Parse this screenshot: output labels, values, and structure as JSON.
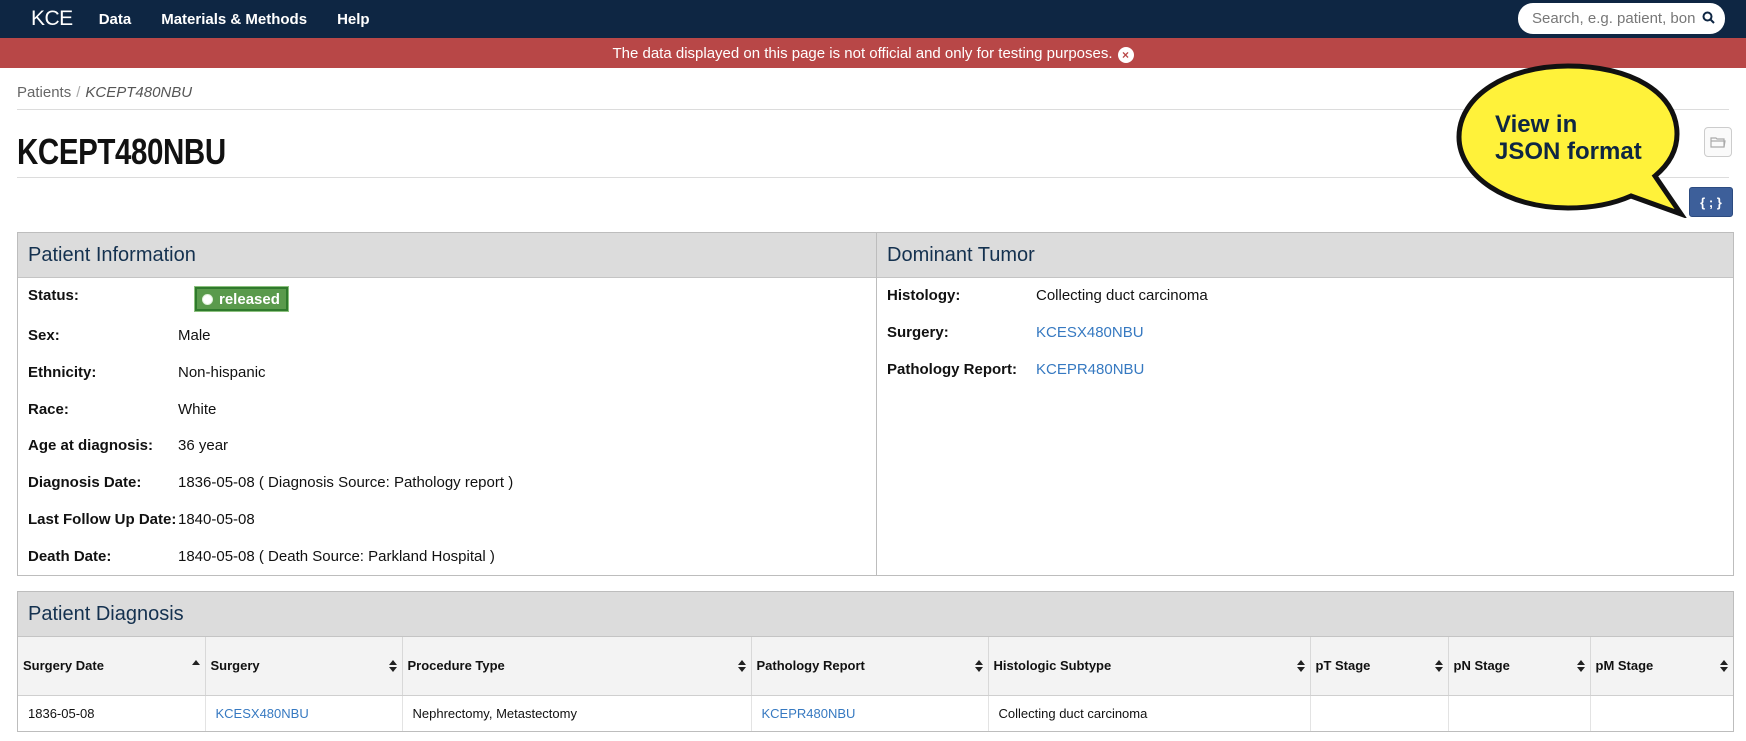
{
  "nav": {
    "brand": "KCE",
    "links": [
      "Data",
      "Materials & Methods",
      "Help"
    ],
    "search_placeholder": "Search, e.g. patient, bon"
  },
  "alert": {
    "text": "The data displayed on this page is not official and only for testing purposes."
  },
  "breadcrumb": {
    "root": "Patients",
    "separator": "/",
    "current": "KCEPT480NBU"
  },
  "page_title": "KCEPT480NBU",
  "callout": {
    "line1": "View in",
    "line2": "JSON format",
    "bubble_color": "#fff23a"
  },
  "json_button": {
    "label": "{ ; }"
  },
  "patient_info": {
    "heading": "Patient Information",
    "status_label": "Status:",
    "status_value": "released",
    "status_color": "#5a9a4c",
    "rows": [
      {
        "label": "Sex:",
        "value": "Male"
      },
      {
        "label": "Ethnicity:",
        "value": "Non-hispanic"
      },
      {
        "label": "Race:",
        "value": "White"
      },
      {
        "label": "Age at diagnosis:",
        "value": "36 year"
      },
      {
        "label": "Diagnosis Date:",
        "value": "1836-05-08 ( Diagnosis Source: Pathology report )"
      },
      {
        "label": "Last Follow Up Date:",
        "value": "1840-05-08"
      },
      {
        "label": "Death Date:",
        "value": "1840-05-08 ( Death Source: Parkland Hospital )"
      }
    ]
  },
  "dominant_tumor": {
    "heading": "Dominant Tumor",
    "histology_label": "Histology:",
    "histology_value": "Collecting duct carcinoma",
    "surgery_label": "Surgery:",
    "surgery_value": "KCESX480NBU",
    "pathology_label": "Pathology Report:",
    "pathology_value": "KCEPR480NBU"
  },
  "diagnosis": {
    "heading": "Patient Diagnosis",
    "columns": [
      "Surgery Date",
      "Surgery",
      "Procedure Type",
      "Pathology Report",
      "Histologic Subtype",
      "pT Stage",
      "pN Stage",
      "pM Stage"
    ],
    "rows": [
      [
        "1836-05-08",
        "KCESX480NBU",
        "Nephrectomy, Metastectomy",
        "KCEPR480NBU",
        "Collecting duct carcinoma",
        "",
        "",
        ""
      ]
    ]
  },
  "colors": {
    "navbar": "#0e2643",
    "alert": "#b84747",
    "link": "#3679c1",
    "json_button": "#3d5f9a"
  }
}
